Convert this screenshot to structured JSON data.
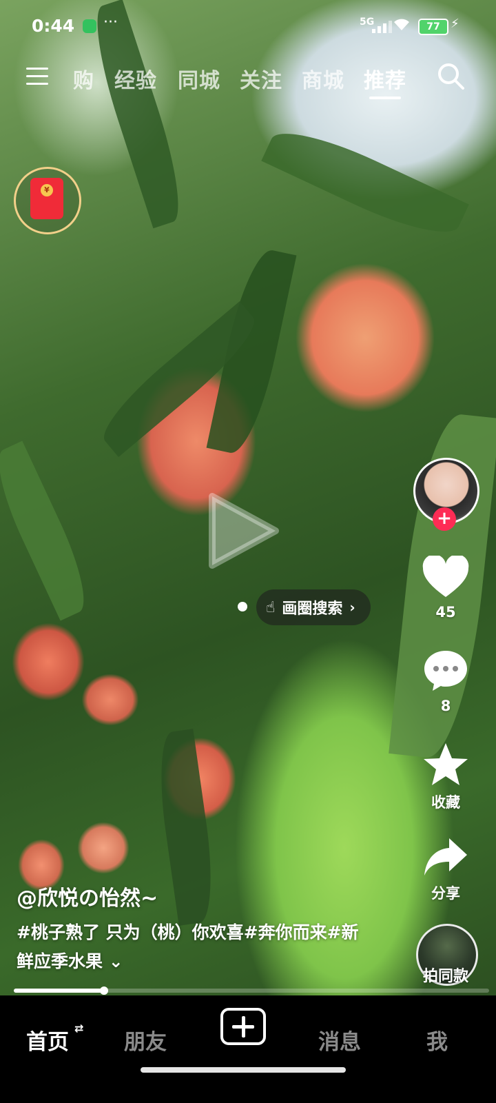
{
  "status_bar": {
    "time": "0:44",
    "dots": "···",
    "network": "5G",
    "battery": "77"
  },
  "top_nav": {
    "tabs": [
      {
        "label": "购",
        "active": false
      },
      {
        "label": "经验",
        "active": false
      },
      {
        "label": "同城",
        "active": false
      },
      {
        "label": "关注",
        "active": false
      },
      {
        "label": "商城",
        "active": false
      },
      {
        "label": "推荐",
        "active": true
      }
    ]
  },
  "red_envelope": {
    "coin_symbol": "¥"
  },
  "circle_search": {
    "label": "画圈搜索"
  },
  "right_rail": {
    "likes": "45",
    "comments": "8",
    "favorite_label": "收藏",
    "share_label": "分享",
    "same_shot_label": "拍同款"
  },
  "post": {
    "author": "@欣悦の怡然~",
    "caption": "#桃子熟了 只为（桃）你欢喜#奔你而来#新鲜应季水果",
    "expand": "⌄"
  },
  "video": {
    "progress_fraction": 0.19
  },
  "bottom_nav": {
    "home": "首页",
    "home_swap": "⇄",
    "friends": "朋友",
    "messages": "消息",
    "me": "我"
  },
  "colors": {
    "accent": "#fe2c55",
    "battery": "#51d36b",
    "envelope": "#f02b38"
  },
  "icons": [
    "menu-icon",
    "search-icon",
    "heart-icon",
    "comment-icon",
    "star-icon",
    "share-icon",
    "plus-icon",
    "play-icon",
    "hand-icon",
    "chevron-right-icon"
  ]
}
